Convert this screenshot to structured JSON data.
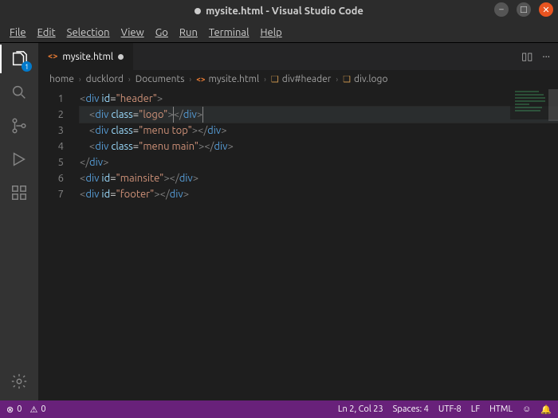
{
  "titlebar": {
    "dirty_dot": true,
    "title": "mysite.html - Visual Studio Code"
  },
  "menubar": {
    "items": [
      "File",
      "Edit",
      "Selection",
      "View",
      "Go",
      "Run",
      "Terminal",
      "Help"
    ]
  },
  "activitybar": {
    "explorer_badge": "1"
  },
  "tab": {
    "icon_text": "<>",
    "label": "mysite.html"
  },
  "tabbar_actions": {
    "split": "▯▯",
    "more": "···"
  },
  "breadcrumbs": {
    "items": [
      {
        "label": "home"
      },
      {
        "label": "ducklord"
      },
      {
        "label": "Documents"
      },
      {
        "icon": "<>",
        "label": "mysite.html"
      },
      {
        "sym": "❑",
        "label": "div#header"
      },
      {
        "sym": "❑",
        "label": "div.logo"
      }
    ],
    "chevron": "›"
  },
  "editor": {
    "line_numbers": [
      "1",
      "2",
      "3",
      "4",
      "5",
      "6",
      "7"
    ],
    "code_lines": [
      {
        "indent": 0,
        "tag": "div",
        "attr": "id",
        "val": "header",
        "selfclose": false
      },
      {
        "indent": 1,
        "tag": "div",
        "attr": "class",
        "val": "logo",
        "selfclose": true,
        "highlight": true,
        "caret": true
      },
      {
        "indent": 1,
        "tag": "div",
        "attr": "class",
        "val": "menu top",
        "selfclose": true
      },
      {
        "indent": 1,
        "tag": "div",
        "attr": "class",
        "val": "menu main",
        "selfclose": true
      },
      {
        "indent": 0,
        "closeonly": "div"
      },
      {
        "indent": 0,
        "tag": "div",
        "attr": "id",
        "val": "mainsite",
        "selfclose": true
      },
      {
        "indent": 0,
        "tag": "div",
        "attr": "id",
        "val": "footer",
        "selfclose": true
      }
    ]
  },
  "statusbar": {
    "errors": "0",
    "warnings": "0",
    "ln_col": "Ln 2, Col 23",
    "spaces": "Spaces: 4",
    "encoding": "UTF-8",
    "eol": "LF",
    "language": "HTML"
  }
}
